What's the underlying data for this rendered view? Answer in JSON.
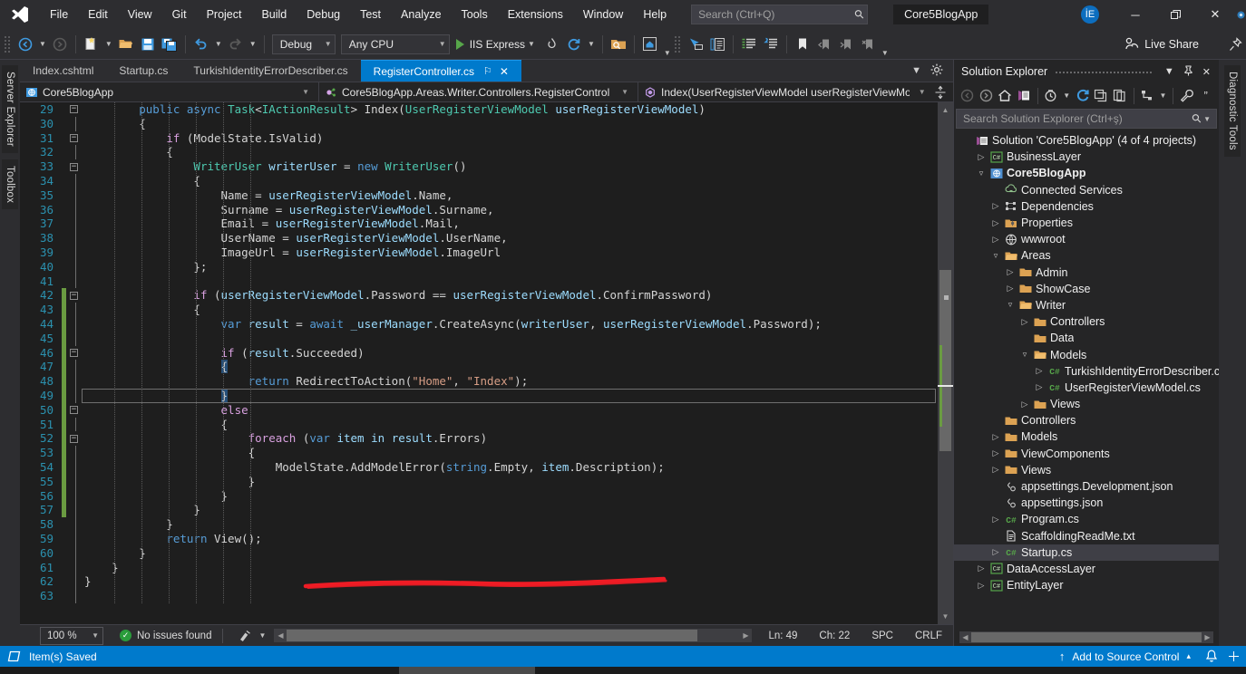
{
  "titlebar": {
    "logo": "visual-studio-logo",
    "menus": [
      "File",
      "Edit",
      "View",
      "Git",
      "Project",
      "Build",
      "Debug",
      "Test",
      "Analyze",
      "Tools",
      "Extensions",
      "Window",
      "Help"
    ],
    "search_placeholder": "Search (Ctrl+Q)",
    "project_name": "Core5BlogApp",
    "avatar_initials": "İE",
    "minimize": "─",
    "restore": "❐",
    "close": "✕"
  },
  "toolbar": {
    "config": "Debug",
    "platform": "Any CPU",
    "run_target": "IIS Express",
    "live_share": "Live Share"
  },
  "editor": {
    "tabs": [
      {
        "label": "Index.cshtml",
        "active": false
      },
      {
        "label": "Startup.cs",
        "active": false
      },
      {
        "label": "TurkishIdentityErrorDescriber.cs",
        "active": false
      },
      {
        "label": "RegisterController.cs",
        "active": true
      }
    ],
    "tab_pin": "⚐",
    "tab_close": "✕",
    "nav": {
      "project": "Core5BlogApp",
      "type": "Core5BlogApp.Areas.Writer.Controllers.RegisterControl",
      "member": "Index(UserRegisterViewModel userRegisterViewModel)"
    },
    "first_line": 29,
    "lines": [
      {
        "n": 29,
        "text": "        public async Task<IActionResult> Index(UserRegisterViewModel userRegisterViewModel)"
      },
      {
        "n": 30,
        "text": "        {"
      },
      {
        "n": 31,
        "text": "            if (ModelState.IsValid)"
      },
      {
        "n": 32,
        "text": "            {"
      },
      {
        "n": 33,
        "text": "                WriterUser writerUser = new WriterUser()"
      },
      {
        "n": 34,
        "text": "                {"
      },
      {
        "n": 35,
        "text": "                    Name = userRegisterViewModel.Name,"
      },
      {
        "n": 36,
        "text": "                    Surname = userRegisterViewModel.Surname,"
      },
      {
        "n": 37,
        "text": "                    Email = userRegisterViewModel.Mail,"
      },
      {
        "n": 38,
        "text": "                    UserName = userRegisterViewModel.UserName,"
      },
      {
        "n": 39,
        "text": "                    ImageUrl = userRegisterViewModel.ImageUrl"
      },
      {
        "n": 40,
        "text": "                };"
      },
      {
        "n": 41,
        "text": ""
      },
      {
        "n": 42,
        "text": "                if (userRegisterViewModel.Password == userRegisterViewModel.ConfirmPassword)"
      },
      {
        "n": 43,
        "text": "                {"
      },
      {
        "n": 44,
        "text": "                    var result = await _userManager.CreateAsync(writerUser, userRegisterViewModel.Password);"
      },
      {
        "n": 45,
        "text": ""
      },
      {
        "n": 46,
        "text": "                    if (result.Succeeded)"
      },
      {
        "n": 47,
        "text": "                    {"
      },
      {
        "n": 48,
        "text": "                        return RedirectToAction(\"Home\", \"Index\");"
      },
      {
        "n": 49,
        "text": "                    }"
      },
      {
        "n": 50,
        "text": "                    else"
      },
      {
        "n": 51,
        "text": "                    {"
      },
      {
        "n": 52,
        "text": "                        foreach (var item in result.Errors)"
      },
      {
        "n": 53,
        "text": "                        {"
      },
      {
        "n": 54,
        "text": "                            ModelState.AddModelError(string.Empty, item.Description);"
      },
      {
        "n": 55,
        "text": "                        }"
      },
      {
        "n": 56,
        "text": "                    }"
      },
      {
        "n": 57,
        "text": "                }"
      },
      {
        "n": 58,
        "text": "            }"
      },
      {
        "n": 59,
        "text": "            return View();"
      },
      {
        "n": 60,
        "text": "        }"
      },
      {
        "n": 61,
        "text": "    }"
      },
      {
        "n": 62,
        "text": "}"
      },
      {
        "n": 63,
        "text": ""
      }
    ],
    "annotation": "red-underline-line-54"
  },
  "editor_footer": {
    "zoom": "100 %",
    "issues": "No issues found",
    "line": "Ln: 49",
    "col": "Ch: 22",
    "spaces": "SPC",
    "eol": "CRLF"
  },
  "solution_explorer": {
    "title": "Solution Explorer",
    "search_placeholder": "Search Solution Explorer (Ctrl+ş)",
    "tree": [
      {
        "depth": 0,
        "label": "Solution 'Core5BlogApp' (4 of 4 projects)",
        "icon": "solution-icon",
        "twisty": "none",
        "bold": false,
        "selected": false
      },
      {
        "depth": 1,
        "label": "BusinessLayer",
        "icon": "csharp-project-icon",
        "twisty": "collapsed",
        "bold": false,
        "selected": false
      },
      {
        "depth": 1,
        "label": "Core5BlogApp",
        "icon": "web-project-icon",
        "twisty": "expanded",
        "bold": true,
        "selected": false
      },
      {
        "depth": 2,
        "label": "Connected Services",
        "icon": "connected-services-icon",
        "twisty": "none",
        "bold": false,
        "selected": false
      },
      {
        "depth": 2,
        "label": "Dependencies",
        "icon": "dependencies-icon",
        "twisty": "collapsed",
        "bold": false,
        "selected": false
      },
      {
        "depth": 2,
        "label": "Properties",
        "icon": "properties-icon",
        "twisty": "collapsed",
        "bold": false,
        "selected": false
      },
      {
        "depth": 2,
        "label": "wwwroot",
        "icon": "wwwroot-icon",
        "twisty": "collapsed",
        "bold": false,
        "selected": false
      },
      {
        "depth": 2,
        "label": "Areas",
        "icon": "folder-open-icon",
        "twisty": "expanded",
        "bold": false,
        "selected": false
      },
      {
        "depth": 3,
        "label": "Admin",
        "icon": "folder-icon",
        "twisty": "collapsed",
        "bold": false,
        "selected": false
      },
      {
        "depth": 3,
        "label": "ShowCase",
        "icon": "folder-icon",
        "twisty": "collapsed",
        "bold": false,
        "selected": false
      },
      {
        "depth": 3,
        "label": "Writer",
        "icon": "folder-open-icon",
        "twisty": "expanded",
        "bold": false,
        "selected": false
      },
      {
        "depth": 4,
        "label": "Controllers",
        "icon": "folder-icon",
        "twisty": "collapsed",
        "bold": false,
        "selected": false
      },
      {
        "depth": 4,
        "label": "Data",
        "icon": "folder-icon",
        "twisty": "none",
        "bold": false,
        "selected": false
      },
      {
        "depth": 4,
        "label": "Models",
        "icon": "folder-open-icon",
        "twisty": "expanded",
        "bold": false,
        "selected": false
      },
      {
        "depth": 5,
        "label": "TurkishIdentityErrorDescriber.cs",
        "icon": "csharp-file-icon",
        "twisty": "collapsed",
        "bold": false,
        "selected": false
      },
      {
        "depth": 5,
        "label": "UserRegisterViewModel.cs",
        "icon": "csharp-file-icon",
        "twisty": "collapsed",
        "bold": false,
        "selected": false
      },
      {
        "depth": 4,
        "label": "Views",
        "icon": "folder-icon",
        "twisty": "collapsed",
        "bold": false,
        "selected": false
      },
      {
        "depth": 2,
        "label": "Controllers",
        "icon": "folder-icon",
        "twisty": "none",
        "bold": false,
        "selected": false
      },
      {
        "depth": 2,
        "label": "Models",
        "icon": "folder-icon",
        "twisty": "collapsed",
        "bold": false,
        "selected": false
      },
      {
        "depth": 2,
        "label": "ViewComponents",
        "icon": "folder-icon",
        "twisty": "collapsed",
        "bold": false,
        "selected": false
      },
      {
        "depth": 2,
        "label": "Views",
        "icon": "folder-icon",
        "twisty": "collapsed",
        "bold": false,
        "selected": false
      },
      {
        "depth": 2,
        "label": "appsettings.Development.json",
        "icon": "json-file-icon",
        "twisty": "none",
        "bold": false,
        "selected": false
      },
      {
        "depth": 2,
        "label": "appsettings.json",
        "icon": "json-file-icon",
        "twisty": "none",
        "bold": false,
        "selected": false
      },
      {
        "depth": 2,
        "label": "Program.cs",
        "icon": "csharp-file-icon",
        "twisty": "collapsed",
        "bold": false,
        "selected": false
      },
      {
        "depth": 2,
        "label": "ScaffoldingReadMe.txt",
        "icon": "text-file-icon",
        "twisty": "none",
        "bold": false,
        "selected": false
      },
      {
        "depth": 2,
        "label": "Startup.cs",
        "icon": "csharp-file-icon",
        "twisty": "collapsed",
        "bold": false,
        "selected": true
      },
      {
        "depth": 1,
        "label": "DataAccessLayer",
        "icon": "csharp-project-icon",
        "twisty": "collapsed",
        "bold": false,
        "selected": false
      },
      {
        "depth": 1,
        "label": "EntityLayer",
        "icon": "csharp-project-icon",
        "twisty": "collapsed",
        "bold": false,
        "selected": false
      }
    ]
  },
  "vertical_tabs": {
    "left": [
      "Server Explorer",
      "Toolbox"
    ],
    "right": [
      "Diagnostic Tools"
    ]
  },
  "statusbar": {
    "message": "Item(s) Saved",
    "source_control": "Add to Source Control",
    "up_arrow": "↑",
    "caret_up": "▴",
    "bell": "bell-icon"
  },
  "colors": {
    "accent": "#007acc",
    "chrome": "#2d2d30",
    "panel": "#252526",
    "editor_bg": "#1e1e1e",
    "annotation_red": "#ee1c25",
    "saved_green": "#6a9b41"
  }
}
